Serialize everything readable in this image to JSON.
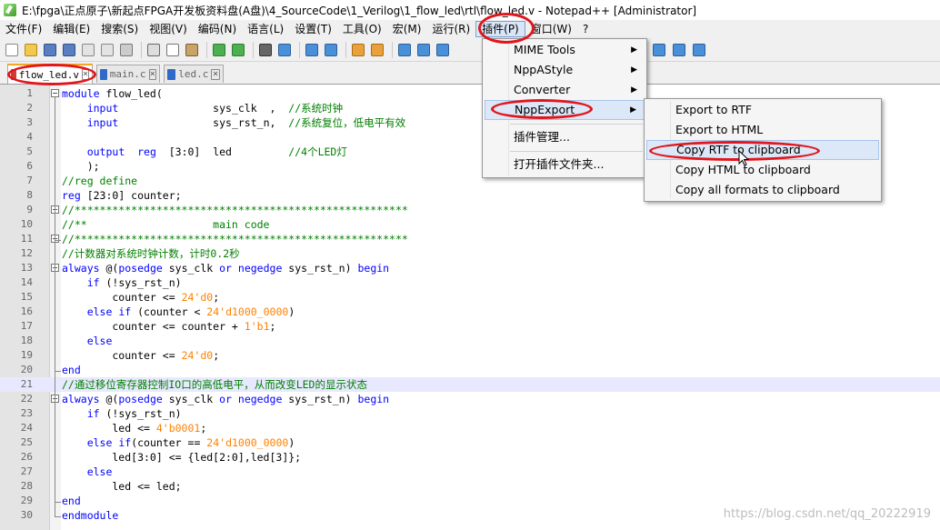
{
  "window": {
    "title": "E:\\fpga\\正点原子\\新起点FPGA开发板资料盘(A盘)\\4_SourceCode\\1_Verilog\\1_flow_led\\rtl\\flow_led.v - Notepad++ [Administrator]"
  },
  "menubar": {
    "items": [
      "文件(F)",
      "编辑(E)",
      "搜索(S)",
      "视图(V)",
      "编码(N)",
      "语言(L)",
      "设置(T)",
      "工具(O)",
      "宏(M)",
      "运行(R)",
      "插件(P)",
      "窗口(W)",
      "?"
    ]
  },
  "tabs": [
    {
      "label": "flow_led.v",
      "active": true
    },
    {
      "label": "main.c",
      "active": false
    },
    {
      "label": "led.c",
      "active": false
    }
  ],
  "plugins_menu": {
    "items": [
      {
        "label": "MIME Tools",
        "submenu": true
      },
      {
        "label": "NppAStyle",
        "submenu": true
      },
      {
        "label": "Converter",
        "submenu": true
      },
      {
        "label": "NppExport",
        "submenu": true
      },
      {
        "label": "插件管理...",
        "submenu": false
      },
      {
        "label": "打开插件文件夹...",
        "submenu": false
      }
    ]
  },
  "nppexport_menu": {
    "items": [
      "Export to RTF",
      "Export to HTML",
      "Copy RTF to clipboard",
      "Copy HTML to clipboard",
      "Copy all formats to clipboard"
    ]
  },
  "editor": {
    "highlighted_line": 21,
    "lines": [
      "module flow_led(",
      "    input               sys_clk  ,  //系统时钟",
      "    input               sys_rst_n,  //系统复位，低电平有效",
      "",
      "    output  reg  [3:0]  led         //4个LED灯",
      "    );",
      "//reg define",
      "reg [23:0] counter;",
      "//*****************************************************",
      "//**                    main code",
      "//*****************************************************",
      "//计数器对系统时钟计数，计时0.2秒",
      "always @(posedge sys_clk or negedge sys_rst_n) begin",
      "    if (!sys_rst_n)",
      "        counter <= 24'd0;",
      "    else if (counter < 24'd1000_0000)",
      "        counter <= counter + 1'b1;",
      "    else",
      "        counter <= 24'd0;",
      "end",
      "//通过移位寄存器控制IO口的高低电平，从而改变LED的显示状态",
      "always @(posedge sys_clk or negedge sys_rst_n) begin",
      "    if (!sys_rst_n)",
      "        led <= 4'b0001;",
      "    else if(counter == 24'd1000_0000)",
      "        led[3:0] <= {led[2:0],led[3]};",
      "    else",
      "        led <= led;",
      "end",
      "endmodule"
    ]
  },
  "watermark": "https://blog.csdn.net/qq_20222919",
  "colors": {
    "keyword": "#0000ff",
    "comment": "#008000",
    "number": "#ff8000",
    "annotation_ring": "#e0161c"
  }
}
